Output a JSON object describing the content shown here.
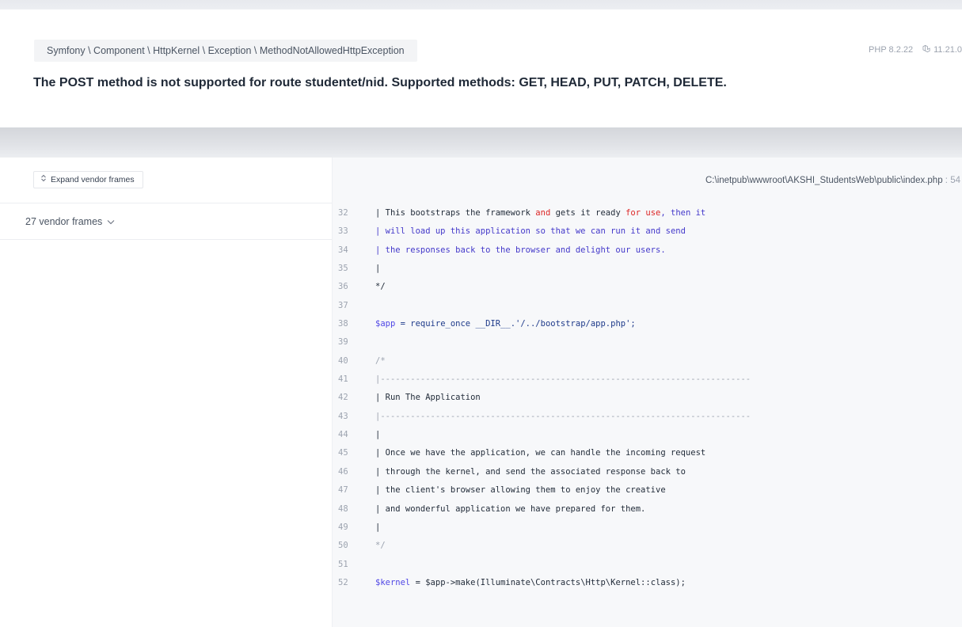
{
  "header": {
    "exception_class": "Symfony \\ Component \\ HttpKernel \\ Exception \\ MethodNotAllowedHttpException",
    "php_version": "PHP 8.2.22",
    "laravel_version": "11.21.0",
    "message": "The POST method is not supported for route studentet/nid. Supported methods: GET, HEAD, PUT, PATCH, DELETE."
  },
  "sidebar": {
    "expand_label": "Expand vendor frames",
    "vendor_frames_label": "27 vendor frames"
  },
  "code": {
    "file_path": "C:\\inetpub\\wwwroot\\AKSHI_StudentsWeb\\public\\index.php",
    "line_number": "54",
    "lines": [
      {
        "n": "32",
        "parts": [
          {
            "t": "| This bootstraps the framework ",
            "c": "src"
          },
          {
            "t": "and",
            "c": "kw"
          },
          {
            "t": " gets it ready ",
            "c": "src"
          },
          {
            "t": "for use",
            "c": "kw"
          },
          {
            "t": ", then it",
            "c": "hl"
          }
        ]
      },
      {
        "n": "33",
        "parts": [
          {
            "t": "| will load up this application so that we can run it and send",
            "c": "hl"
          }
        ]
      },
      {
        "n": "34",
        "parts": [
          {
            "t": "| the responses back to the browser and delight our users.",
            "c": "hl"
          }
        ]
      },
      {
        "n": "35",
        "parts": [
          {
            "t": "|",
            "c": "src"
          }
        ]
      },
      {
        "n": "36",
        "parts": [
          {
            "t": "*/",
            "c": "src"
          }
        ]
      },
      {
        "n": "37",
        "parts": [
          {
            "t": "",
            "c": "src"
          }
        ]
      },
      {
        "n": "38",
        "parts": [
          {
            "t": "$app",
            "c": "var"
          },
          {
            "t": " = require_once __DIR__.'/../bootstrap/app.php';",
            "c": "str"
          }
        ]
      },
      {
        "n": "39",
        "parts": [
          {
            "t": "",
            "c": "src"
          }
        ]
      },
      {
        "n": "40",
        "parts": [
          {
            "t": "/*",
            "c": "muted"
          }
        ]
      },
      {
        "n": "41",
        "parts": [
          {
            "t": "|--------------------------------------------------------------------------",
            "c": "muted"
          }
        ]
      },
      {
        "n": "42",
        "parts": [
          {
            "t": "| Run The Application",
            "c": "src"
          }
        ]
      },
      {
        "n": "43",
        "parts": [
          {
            "t": "|--------------------------------------------------------------------------",
            "c": "muted"
          }
        ]
      },
      {
        "n": "44",
        "parts": [
          {
            "t": "|",
            "c": "src"
          }
        ]
      },
      {
        "n": "45",
        "parts": [
          {
            "t": "| Once we have the application, we can handle the incoming request",
            "c": "src"
          }
        ]
      },
      {
        "n": "46",
        "parts": [
          {
            "t": "| through the kernel, and send the associated response back to",
            "c": "src"
          }
        ]
      },
      {
        "n": "47",
        "parts": [
          {
            "t": "| the client's browser allowing them to enjoy the creative",
            "c": "src"
          }
        ]
      },
      {
        "n": "48",
        "parts": [
          {
            "t": "| and wonderful application we have prepared for them.",
            "c": "src"
          }
        ]
      },
      {
        "n": "49",
        "parts": [
          {
            "t": "|",
            "c": "src"
          }
        ]
      },
      {
        "n": "50",
        "parts": [
          {
            "t": "*/",
            "c": "muted"
          }
        ]
      },
      {
        "n": "51",
        "parts": [
          {
            "t": "",
            "c": "src"
          }
        ]
      },
      {
        "n": "52",
        "parts": [
          {
            "t": "$kernel",
            "c": "var"
          },
          {
            "t": " = $app->make(Illuminate\\Contracts\\Http\\Kernel::class);",
            "c": "src"
          }
        ]
      }
    ]
  }
}
